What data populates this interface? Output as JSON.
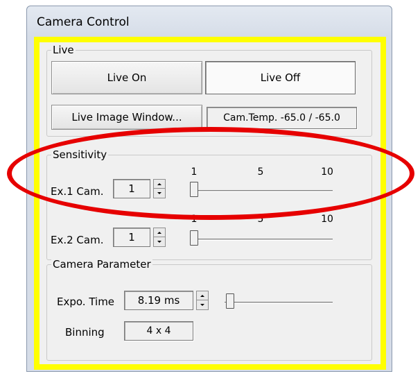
{
  "window": {
    "title": "Camera Control"
  },
  "live": {
    "group_label": "Live",
    "live_on_label": "Live On",
    "live_off_label": "Live Off",
    "live_image_window_label": "Live Image Window...",
    "cam_temp_text": "Cam.Temp. -65.0 / -65.0"
  },
  "sensitivity": {
    "group_label": "Sensitivity",
    "ex1": {
      "label": "Ex.1 Cam.",
      "value": "1",
      "slider_ticks": [
        "1",
        "5",
        "10"
      ],
      "slider_value": 1,
      "slider_min": 1,
      "slider_max": 10
    },
    "ex2": {
      "label": "Ex.2 Cam.",
      "value": "1",
      "slider_ticks": [
        "1",
        "5",
        "10"
      ],
      "slider_value": 1,
      "slider_min": 1,
      "slider_max": 10
    }
  },
  "camera_parameter": {
    "group_label": "Camera Parameter",
    "expo_time_label": "Expo. Time",
    "expo_time_value": "8.19 ms",
    "binning_label": "Binning",
    "binning_value": "4 x 4"
  },
  "colors": {
    "highlight_border": "#ffff00",
    "annotation_ellipse": "#e60000"
  }
}
